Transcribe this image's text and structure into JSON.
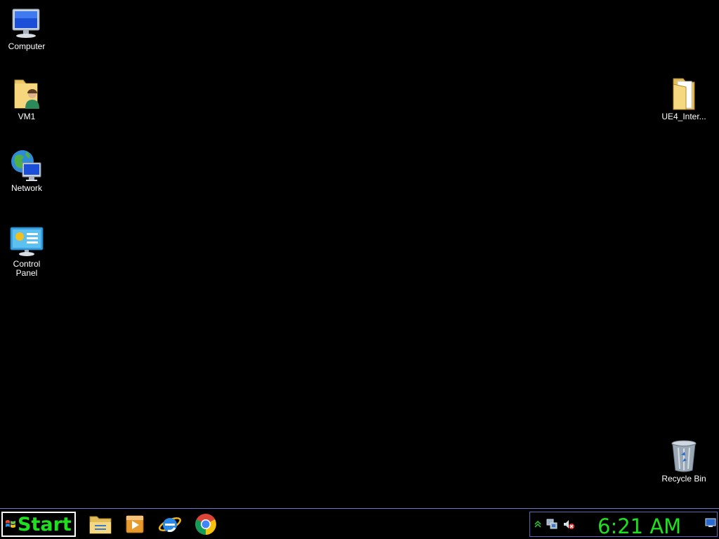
{
  "desktop": {
    "icons": [
      {
        "label": "Computer",
        "icon": "computer-icon"
      },
      {
        "label": "VM1",
        "icon": "user-folder-icon"
      },
      {
        "label": "Network",
        "icon": "network-icon"
      },
      {
        "label": "Control\nPanel",
        "icon": "control-panel-icon"
      },
      {
        "label": "UE4_Inter...",
        "icon": "folder-icon"
      },
      {
        "label": "Recycle Bin",
        "icon": "recycle-bin-icon"
      }
    ]
  },
  "taskbar": {
    "start_label": "Start",
    "pinned": [
      {
        "name": "File Explorer",
        "icon": "file-explorer-icon"
      },
      {
        "name": "Windows Media Player",
        "icon": "media-player-icon"
      },
      {
        "name": "Internet Explorer",
        "icon": "internet-explorer-icon"
      },
      {
        "name": "Google Chrome",
        "icon": "chrome-icon"
      }
    ],
    "tray": {
      "icons": [
        "show-hidden-icons-icon",
        "network-status-icon",
        "volume-muted-icon"
      ],
      "clock": "6:21 AM"
    }
  },
  "colors": {
    "background": "#000000",
    "accent_green": "#1fe01f",
    "taskbar_border": "#6c78c8"
  }
}
